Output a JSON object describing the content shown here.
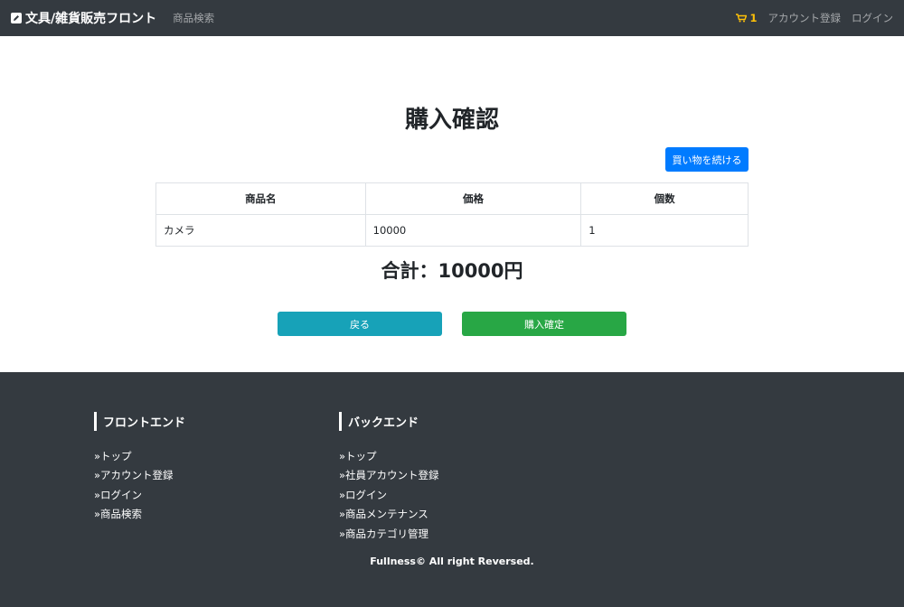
{
  "navbar": {
    "brand": "文具/雑貨販売フロント",
    "brand_icon": "edit-icon",
    "search_link": "商品検索",
    "cart_icon": "cart-icon",
    "cart_count": "1",
    "register_link": "アカウント登録",
    "login_link": "ログイン"
  },
  "main": {
    "title": "購入確認",
    "continue_label": "買い物を続ける",
    "table": {
      "headers": [
        "商品名",
        "価格",
        "個数"
      ],
      "rows": [
        [
          "カメラ",
          "10000",
          "1"
        ]
      ]
    },
    "total": "合計：10000円",
    "back_label": "戻る",
    "confirm_label": "購入確定"
  },
  "footer": {
    "frontend": {
      "title": "フロントエンド",
      "links": [
        "»トップ",
        "»アカウント登録",
        "»ログイン",
        "»商品検索"
      ]
    },
    "backend": {
      "title": "バックエンド",
      "links": [
        "»トップ",
        "»社員アカウント登録",
        "»ログイン",
        "»商品メンテナンス",
        "»商品カテゴリ管理"
      ]
    },
    "copyright": "Fullness© All right Reversed."
  },
  "colors": {
    "navbar_bg": "#343a40",
    "primary": "#007bff",
    "info": "#17a2b8",
    "success": "#28a745",
    "cart": "#ffc107"
  }
}
